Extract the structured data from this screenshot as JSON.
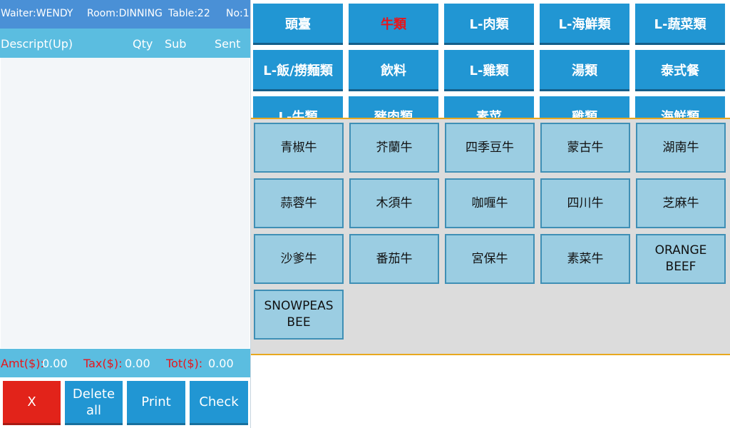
{
  "header": {
    "waiter": "Waiter:WENDY",
    "room": "Room:DINNING",
    "table": "Table:22",
    "no": "No:1"
  },
  "columns": {
    "description": "Descript(Up)",
    "qty": "Qty",
    "sub": "Sub",
    "sent": "Sent"
  },
  "totals": {
    "amt_label": "Amt($):",
    "amt_value": "0.00",
    "tax_label": "Tax($):",
    "tax_value": "0.00",
    "tot_label": "Tot($):",
    "tot_value": "0.00"
  },
  "actions": {
    "cancel": "X",
    "delete_all_line1": "Delete",
    "delete_all_line2": "all",
    "print": "Print",
    "check": "Check"
  },
  "categories": [
    "頭臺",
    "牛類",
    "L-肉類",
    "L-海鮮類",
    "L-蔬菜類",
    "L-飯/撈麵類",
    "飲料",
    "L-雞類",
    "湯類",
    "泰式餐",
    "L-牛類",
    "豬肉類",
    "素菜",
    "雞類",
    "海鮮類"
  ],
  "active_category": "牛類",
  "items": [
    "青椒牛",
    "芥蘭牛",
    "四季豆牛",
    "蒙古牛",
    "湖南牛",
    "蒜蓉牛",
    "木須牛",
    "咖喱牛",
    "四川牛",
    "芝麻牛",
    "沙爹牛",
    "番茄牛",
    "宮保牛",
    "素菜牛",
    "ORANGE BEEF",
    "SNOWPEAS BEE"
  ],
  "colors": {
    "header_bg": "#4a90d6",
    "column_header_bg": "#5bbde0",
    "category_button": "#2196d3",
    "item_button": "#9bcde2",
    "cancel_button": "#e2231a",
    "action_button": "#2196d3",
    "active_text": "#e8151b",
    "divider": "#e8a81e"
  }
}
